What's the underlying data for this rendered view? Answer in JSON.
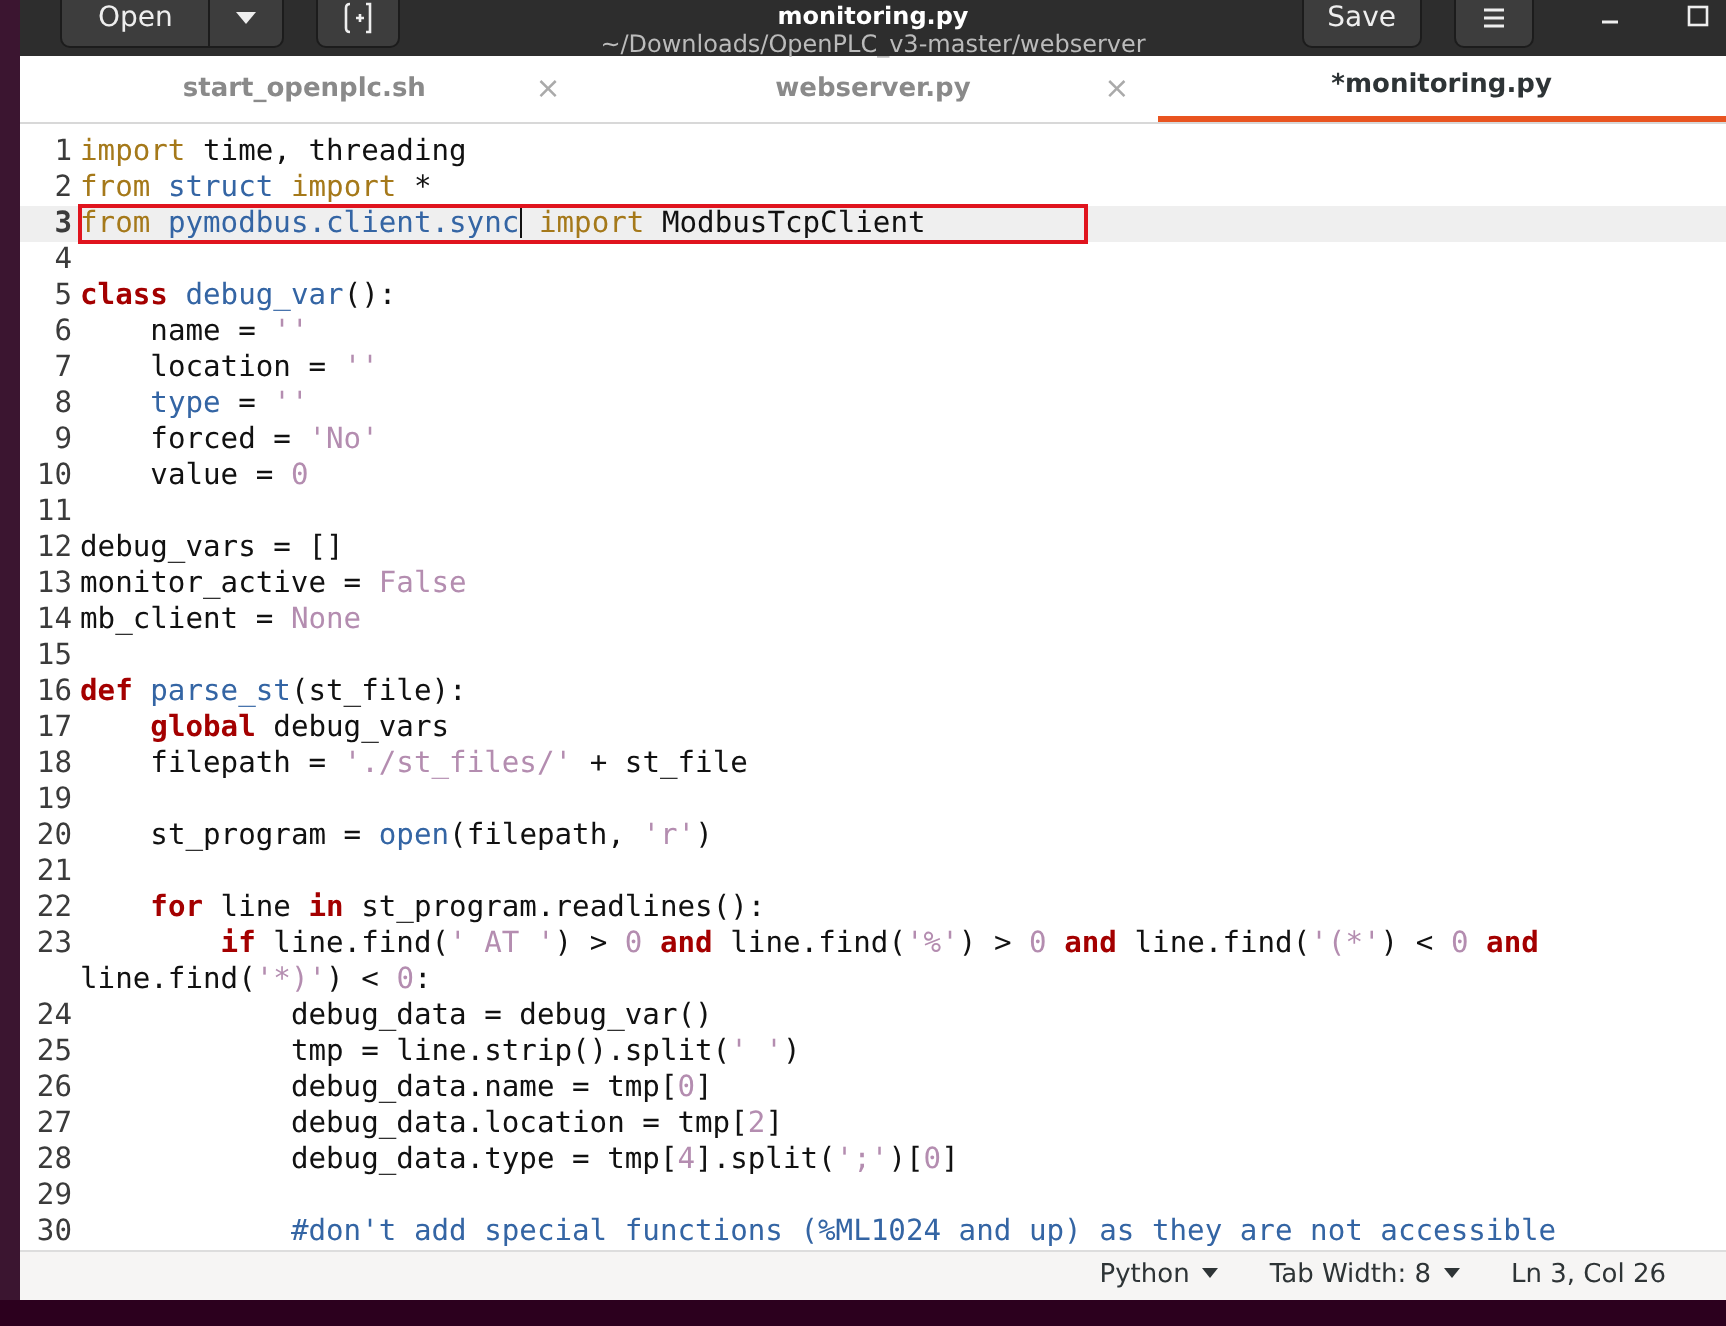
{
  "window": {
    "title": "monitoring.py",
    "subtitle": "~/Downloads/OpenPLC_v3-master/webserver",
    "open_button": "Open",
    "save_button": "Save"
  },
  "tabs": [
    {
      "label": "start_openplc.sh",
      "selected": false,
      "close": "×"
    },
    {
      "label": "webserver.py",
      "selected": false,
      "close": "×"
    },
    {
      "label": "*monitoring.py",
      "selected": true
    }
  ],
  "editor": {
    "lines": [
      {
        "number": "1",
        "current": false,
        "boxed": false,
        "tokens": [
          {
            "kind": "keyword",
            "text": "import"
          },
          {
            "kind": "text",
            "text": " time, threading"
          }
        ]
      },
      {
        "number": "2",
        "current": false,
        "boxed": false,
        "tokens": [
          {
            "kind": "keyword",
            "text": "from"
          },
          {
            "kind": "identifier",
            "text": " struct"
          },
          {
            "kind": "keyword",
            "text": " import"
          },
          {
            "kind": "text",
            "text": " *"
          }
        ]
      },
      {
        "number": "3",
        "current": true,
        "boxed": true,
        "tokens": [
          {
            "kind": "keyword",
            "text": "from"
          },
          {
            "kind": "identifier",
            "text": " pymodbus.client.sync"
          },
          {
            "kind": "cursor"
          },
          {
            "kind": "keyword",
            "text": " import"
          },
          {
            "kind": "text",
            "text": " ModbusTcpClient"
          }
        ]
      },
      {
        "number": "4",
        "current": false,
        "boxed": false
      },
      {
        "number": "5",
        "current": false,
        "boxed": false,
        "tokens": [
          {
            "kind": "statement",
            "text": "class"
          },
          {
            "kind": "identifier",
            "text": " debug_var"
          },
          {
            "kind": "text",
            "text": "():"
          }
        ]
      },
      {
        "number": "6",
        "current": false,
        "boxed": false,
        "tokens": [
          {
            "kind": "text",
            "text": "    name = "
          },
          {
            "kind": "literal",
            "text": "''"
          }
        ]
      },
      {
        "number": "7",
        "current": false,
        "boxed": false,
        "tokens": [
          {
            "kind": "text",
            "text": "    location = "
          },
          {
            "kind": "literal",
            "text": "''"
          }
        ]
      },
      {
        "number": "8",
        "current": false,
        "boxed": false,
        "tokens": [
          {
            "kind": "identifier",
            "text": "    type"
          },
          {
            "kind": "text",
            "text": " = "
          },
          {
            "kind": "literal",
            "text": "''"
          }
        ]
      },
      {
        "number": "9",
        "current": false,
        "boxed": false,
        "tokens": [
          {
            "kind": "text",
            "text": "    forced = "
          },
          {
            "kind": "literal",
            "text": "'No'"
          }
        ]
      },
      {
        "number": "10",
        "current": false,
        "boxed": false,
        "tokens": [
          {
            "kind": "text",
            "text": "    value = "
          },
          {
            "kind": "literal",
            "text": "0"
          }
        ]
      },
      {
        "number": "11",
        "current": false,
        "boxed": false
      },
      {
        "number": "12",
        "current": false,
        "boxed": false,
        "tokens": [
          {
            "kind": "text",
            "text": "debug_vars = []"
          }
        ]
      },
      {
        "number": "13",
        "current": false,
        "boxed": false,
        "tokens": [
          {
            "kind": "text",
            "text": "monitor_active = "
          },
          {
            "kind": "literal",
            "text": "False"
          }
        ]
      },
      {
        "number": "14",
        "current": false,
        "boxed": false,
        "tokens": [
          {
            "kind": "text",
            "text": "mb_client = "
          },
          {
            "kind": "literal",
            "text": "None"
          }
        ]
      },
      {
        "number": "15",
        "current": false,
        "boxed": false
      },
      {
        "number": "16",
        "current": false,
        "boxed": false,
        "tokens": [
          {
            "kind": "statement",
            "text": "def"
          },
          {
            "kind": "identifier",
            "text": " parse_st"
          },
          {
            "kind": "text",
            "text": "(st_file):"
          }
        ]
      },
      {
        "number": "17",
        "current": false,
        "boxed": false,
        "tokens": [
          {
            "kind": "statement",
            "text": "    global"
          },
          {
            "kind": "text",
            "text": " debug_vars"
          }
        ]
      },
      {
        "number": "18",
        "current": false,
        "boxed": false,
        "tokens": [
          {
            "kind": "text",
            "text": "    filepath = "
          },
          {
            "kind": "literal",
            "text": "'./st_files/'"
          },
          {
            "kind": "text",
            "text": " + st_file"
          }
        ]
      },
      {
        "number": "19",
        "current": false,
        "boxed": false
      },
      {
        "number": "20",
        "current": false,
        "boxed": false,
        "tokens": [
          {
            "kind": "text",
            "text": "    st_program = "
          },
          {
            "kind": "identifier",
            "text": "open"
          },
          {
            "kind": "text",
            "text": "(filepath, "
          },
          {
            "kind": "literal",
            "text": "'r'"
          },
          {
            "kind": "text",
            "text": ")"
          }
        ]
      },
      {
        "number": "21",
        "current": false,
        "boxed": false
      },
      {
        "number": "22",
        "current": false,
        "boxed": false,
        "tokens": [
          {
            "kind": "statement",
            "text": "    for"
          },
          {
            "kind": "text",
            "text": " line "
          },
          {
            "kind": "statement",
            "text": "in"
          },
          {
            "kind": "text",
            "text": " st_program.readlines():"
          }
        ]
      },
      {
        "number": "23",
        "current": false,
        "boxed": false,
        "tokens": [
          {
            "kind": "statement",
            "text": "        if"
          },
          {
            "kind": "text",
            "text": " line.find("
          },
          {
            "kind": "literal",
            "text": "' AT '"
          },
          {
            "kind": "text",
            "text": ") > "
          },
          {
            "kind": "literal",
            "text": "0"
          },
          {
            "kind": "statement",
            "text": " and"
          },
          {
            "kind": "text",
            "text": " line.find("
          },
          {
            "kind": "literal",
            "text": "'%'"
          },
          {
            "kind": "text",
            "text": ") > "
          },
          {
            "kind": "literal",
            "text": "0"
          },
          {
            "kind": "statement",
            "text": " and"
          },
          {
            "kind": "text",
            "text": " line.find("
          },
          {
            "kind": "literal",
            "text": "'(*'"
          },
          {
            "kind": "text",
            "text": ") < "
          },
          {
            "kind": "literal",
            "text": "0"
          },
          {
            "kind": "statement",
            "text": " and"
          },
          {
            "kind": "text",
            "text": " line.find("
          },
          {
            "kind": "literal",
            "text": "'*)'"
          },
          {
            "kind": "text",
            "text": ") < "
          },
          {
            "kind": "literal",
            "text": "0"
          },
          {
            "kind": "text",
            "text": ":"
          }
        ]
      },
      {
        "number": "24",
        "current": false,
        "boxed": false,
        "tokens": [
          {
            "kind": "text",
            "text": "            debug_data = debug_var()"
          }
        ]
      },
      {
        "number": "25",
        "current": false,
        "boxed": false,
        "tokens": [
          {
            "kind": "text",
            "text": "            tmp = line.strip().split("
          },
          {
            "kind": "literal",
            "text": "' '"
          },
          {
            "kind": "text",
            "text": ")"
          }
        ]
      },
      {
        "number": "26",
        "current": false,
        "boxed": false,
        "tokens": [
          {
            "kind": "text",
            "text": "            debug_data.name = tmp["
          },
          {
            "kind": "literal",
            "text": "0"
          },
          {
            "kind": "text",
            "text": "]"
          }
        ]
      },
      {
        "number": "27",
        "current": false,
        "boxed": false,
        "tokens": [
          {
            "kind": "text",
            "text": "            debug_data.location = tmp["
          },
          {
            "kind": "literal",
            "text": "2"
          },
          {
            "kind": "text",
            "text": "]"
          }
        ]
      },
      {
        "number": "28",
        "current": false,
        "boxed": false,
        "tokens": [
          {
            "kind": "text",
            "text": "            debug_data.type = tmp["
          },
          {
            "kind": "literal",
            "text": "4"
          },
          {
            "kind": "text",
            "text": "].split("
          },
          {
            "kind": "literal",
            "text": "';'"
          },
          {
            "kind": "text",
            "text": ")["
          },
          {
            "kind": "literal",
            "text": "0"
          },
          {
            "kind": "text",
            "text": "]"
          }
        ]
      },
      {
        "number": "29",
        "current": false,
        "boxed": false
      },
      {
        "number": "30",
        "current": false,
        "boxed": false,
        "tokens": [
          {
            "kind": "comment",
            "text": "            #don't add special functions (%ML1024 and up) as they are not accessible"
          }
        ]
      }
    ]
  },
  "status_bar": {
    "language": "Python",
    "tab_width": "Tab Width: 8",
    "position": "Ln 3, Col 26"
  }
}
